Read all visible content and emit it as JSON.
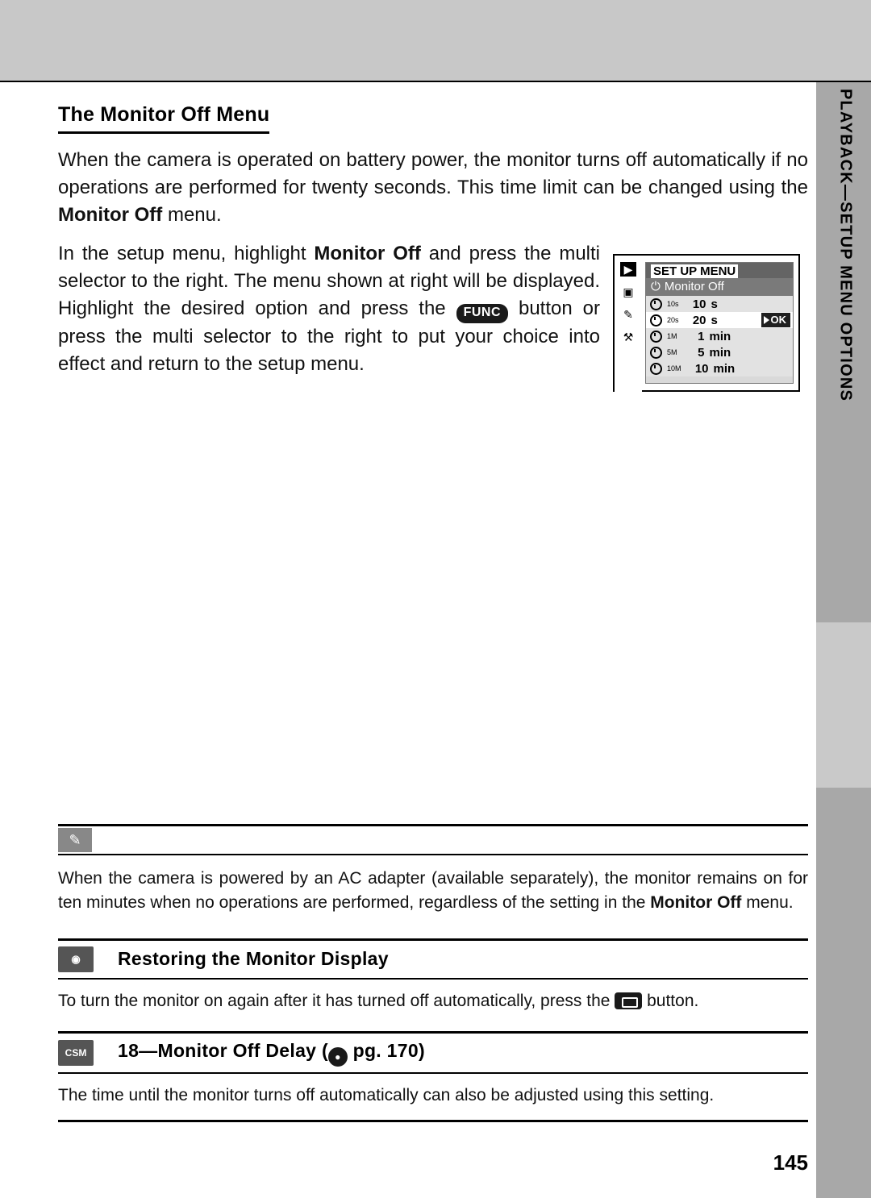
{
  "sidebar": {
    "label": "PLAYBACK—SETUP MENU OPTIONS"
  },
  "page": {
    "title": "The Monitor Off Menu",
    "paragraph1": "When the camera is operated on battery power, the monitor turns off automatically if no operations are performed for twenty seconds. This time limit can be changed using the ",
    "paragraph1_bold": "Monitor Off",
    "paragraph1_end": " menu.",
    "paragraph2_a": "In the setup menu, highlight ",
    "paragraph2_bold": "Monitor Off",
    "paragraph2_b": " and press the multi selector to the right. The menu shown at right will be displayed. Highlight the desired option and press the ",
    "func_button": "FUNC",
    "paragraph2_c": " button or press the multi selector to the right to put your choice into effect and return to the setup menu.",
    "number": "145"
  },
  "lcd": {
    "title": "SET UP MENU",
    "subtitle": "Monitor Off",
    "ok_label": "OK",
    "rows": [
      {
        "tag": "10s",
        "value": "10",
        "unit": "s",
        "highlighted": false
      },
      {
        "tag": "20s",
        "value": "20",
        "unit": "s",
        "highlighted": true
      },
      {
        "tag": "1M",
        "value": "1",
        "unit": "min",
        "highlighted": false
      },
      {
        "tag": "5M",
        "value": "5",
        "unit": "min",
        "highlighted": false
      },
      {
        "tag": "10M",
        "value": "10",
        "unit": "min",
        "highlighted": false
      }
    ],
    "side_icons": [
      "play-icon",
      "camera-icon",
      "pencil-icon",
      "wrench-icon"
    ]
  },
  "notes": {
    "ac_note_a": "When the camera is powered by an AC adapter (available separately), the monitor remains on for ten minutes when no operations are performed, regardless of the setting in the ",
    "ac_note_bold": "Monitor Off",
    "ac_note_b": " menu.",
    "restore_title": "Restoring the Monitor Display",
    "restore_body_a": "To turn the monitor on again after it has turned off automatically, press the ",
    "restore_body_b": " button.",
    "csm_badge": "CSM",
    "csm_title_a": "18—Monitor Off Delay (",
    "csm_title_b": " pg. 170)",
    "csm_body": "The time until the monitor turns off automatically can also be adjusted using this setting."
  }
}
